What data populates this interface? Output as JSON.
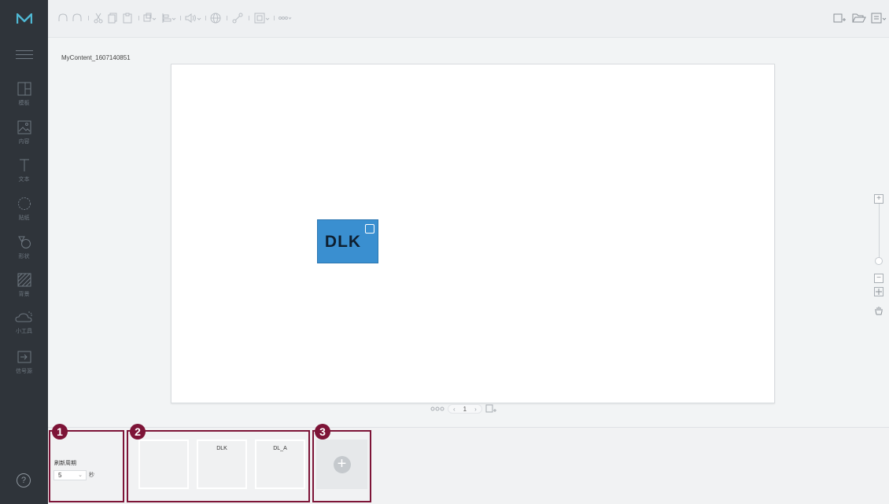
{
  "app": {
    "logo": "M",
    "accent": "#7d1437",
    "canvas_widget_color": "#3a8fd0"
  },
  "document": {
    "filename": "MyContent_1607140851"
  },
  "sidebar": {
    "items": [
      {
        "label": "模板",
        "icon": "template-icon"
      },
      {
        "label": "内容",
        "icon": "image-icon"
      },
      {
        "label": "文本",
        "icon": "text-icon"
      },
      {
        "label": "贴纸",
        "icon": "sticker-icon"
      },
      {
        "label": "形状",
        "icon": "shape-icon"
      },
      {
        "label": "背景",
        "icon": "background-icon"
      },
      {
        "label": "小工具",
        "icon": "widget-icon"
      },
      {
        "label": "信号源",
        "icon": "input-source-icon"
      }
    ],
    "help": "?"
  },
  "canvas": {
    "widget_text": "DLK"
  },
  "page_nav": {
    "prev": "‹",
    "current_page": "1",
    "next": "›"
  },
  "zoom": {
    "plus": "+",
    "minus": "−"
  },
  "bottom_panel": {
    "callouts": [
      "1",
      "2",
      "3"
    ],
    "refresh": {
      "label": "刷新周期",
      "value": "5",
      "unit": "秒"
    },
    "pages": [
      {
        "label": ""
      },
      {
        "label": "DLK"
      },
      {
        "label": "DL_A"
      }
    ],
    "add_page": "+"
  }
}
